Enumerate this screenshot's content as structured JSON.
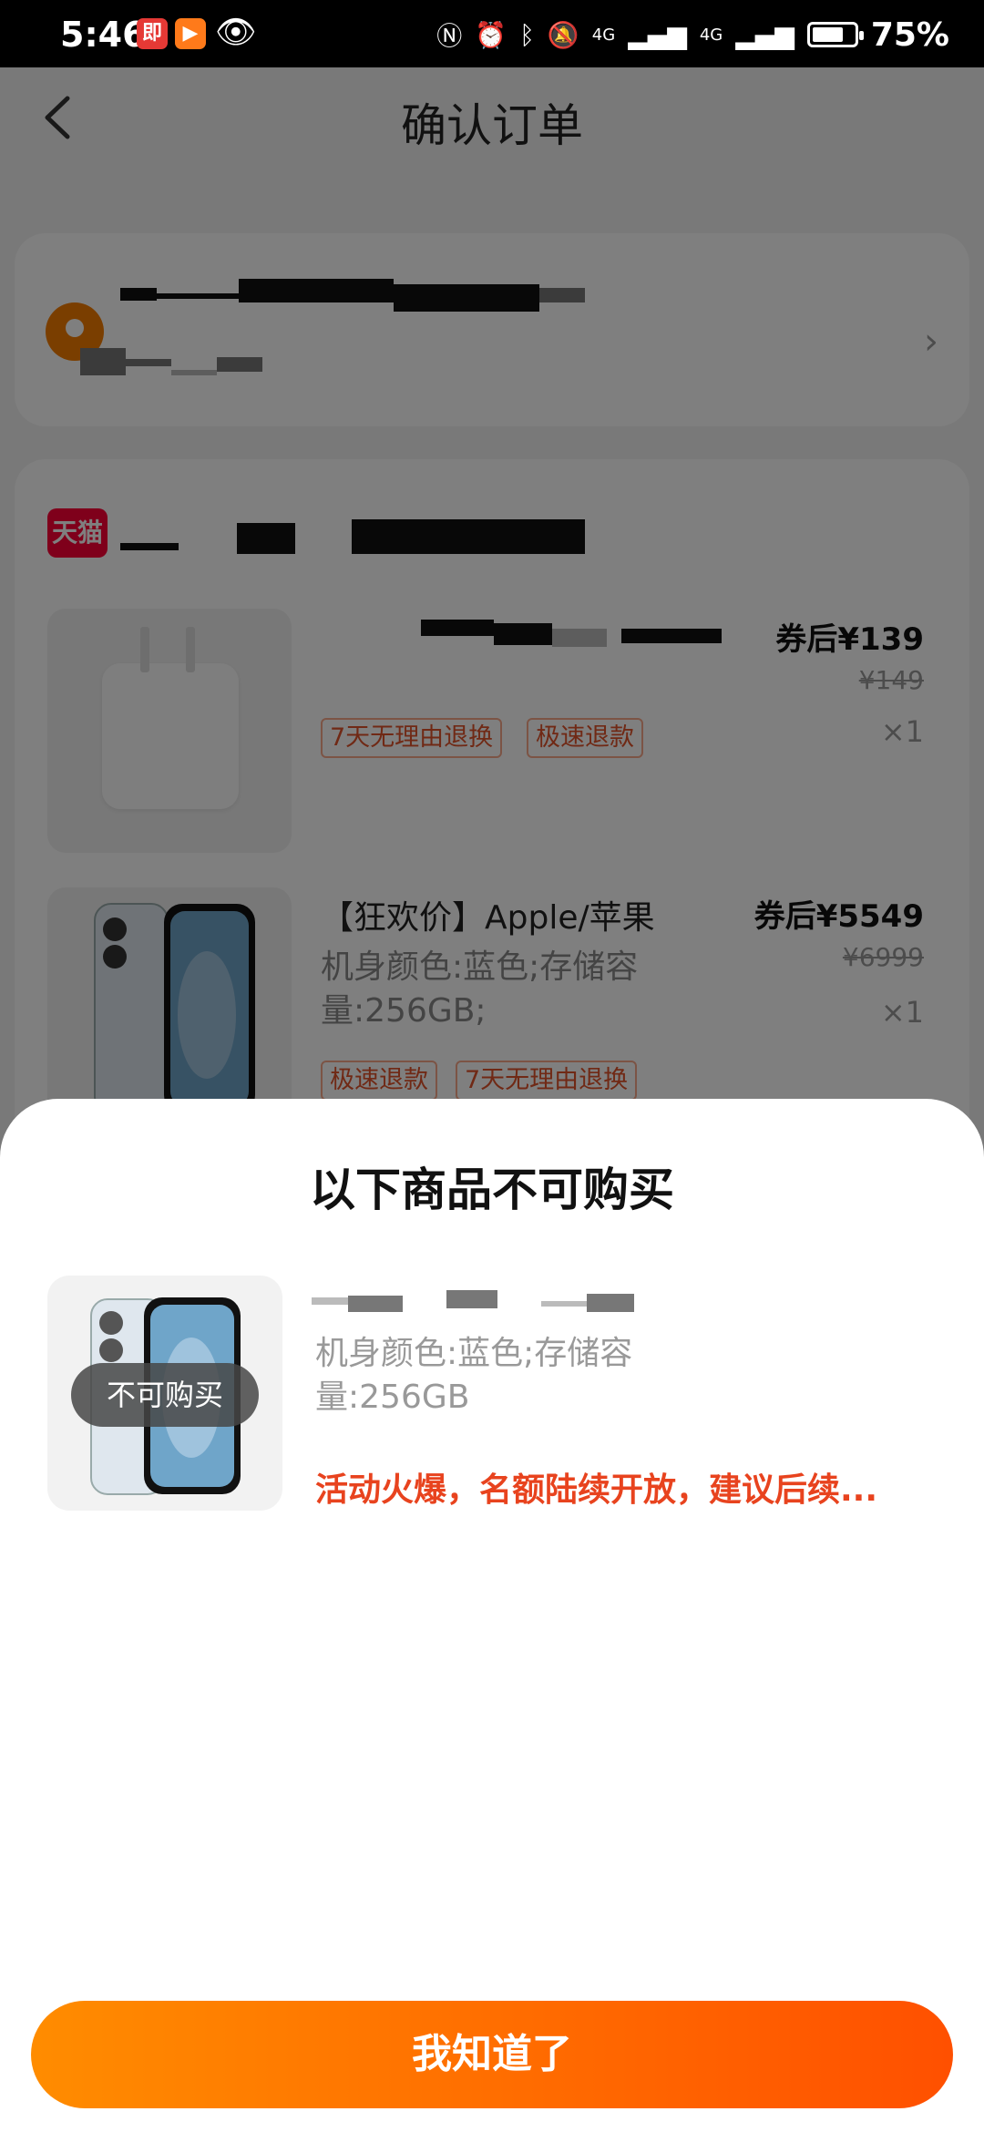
{
  "status_bar": {
    "time": "5:46",
    "battery": "75%",
    "battery_level": 0.75,
    "app_badge_1": "即",
    "network_1": "4G",
    "network_2": "4G"
  },
  "header": {
    "title": "确认订单"
  },
  "icons": {
    "back": "back-arrow-icon",
    "location": "location-pin-icon",
    "chevron": "chevron-right-icon",
    "store": "tmall-logo-icon"
  },
  "store": {
    "badge": "天猫"
  },
  "items": [
    {
      "price_after": "券后¥139",
      "price_original": "¥149",
      "quantity": "×1",
      "tags": [
        "7天无理由退换",
        "极速退款"
      ]
    },
    {
      "title": "【狂欢价】Apple/苹果",
      "spec": "机身颜色:蓝色;存储容量:256GB;",
      "price_after": "券后¥5549",
      "price_original": "¥6999",
      "quantity": "×1",
      "tags": [
        "极速退款",
        "7天无理由退换"
      ]
    }
  ],
  "sheet": {
    "title": "以下商品不可购买",
    "badge": "不可购买",
    "spec": "机身颜色:蓝色;存储容量:256GB",
    "warning": "活动火爆，名额陆续开放，建议后续...",
    "button": "我知道了"
  },
  "colors": {
    "accent": "#ff5000",
    "warning": "#e8431e",
    "tmall": "#ff0036"
  }
}
